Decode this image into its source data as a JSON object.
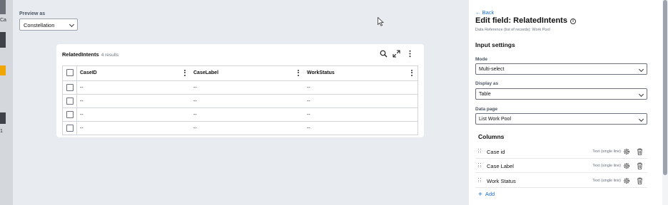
{
  "left_strip": {
    "text1": "Ca",
    "text2": "1"
  },
  "preview": {
    "label": "Preview as",
    "selected": "Constellation"
  },
  "card": {
    "title": "RelatedIntents",
    "count": "4 results",
    "columns": [
      "CaseID",
      "CaseLabel",
      "WorkStatus"
    ],
    "rows": [
      [
        "--",
        "--",
        "--"
      ],
      [
        "--",
        "--",
        "--"
      ],
      [
        "--",
        "--",
        "--"
      ],
      [
        "--",
        "--",
        "--"
      ]
    ]
  },
  "panel": {
    "back_label": "Back",
    "title": "Edit field: RelatedIntents",
    "info_glyph": "i",
    "subtitle": "Data Reference (list of records): Work Pool",
    "input_settings": "Input settings",
    "mode_label": "Mode",
    "mode_value": "Multi-select",
    "display_label": "Display as",
    "display_value": "Table",
    "datapage_label": "Data page",
    "datapage_value": "List Work Pool",
    "columns_heading": "Columns",
    "columns": [
      {
        "name": "Case id",
        "type": "Text (single line)"
      },
      {
        "name": "Case Label",
        "type": "Text (single line)"
      },
      {
        "name": "Work Status",
        "type": "Text (single line)"
      }
    ],
    "add_icon": "+",
    "add_label": "Add"
  },
  "colors": {
    "accent": "#1d6fd8",
    "canvas": "#e8ecf1"
  }
}
